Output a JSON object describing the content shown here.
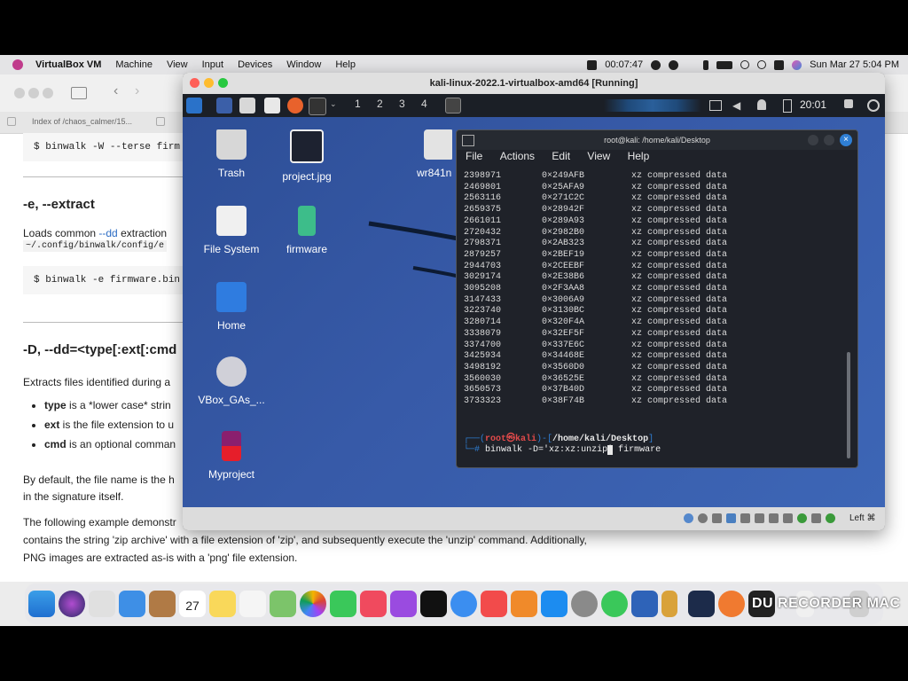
{
  "menubar": {
    "app": "VirtualBox VM",
    "items": [
      "Machine",
      "View",
      "Input",
      "Devices",
      "Window",
      "Help"
    ],
    "timer": "00:07:47",
    "datetime": "Sun Mar 27  5:04 PM"
  },
  "browser": {
    "tab1": "Index of /chaos_calmer/15...",
    "code1": "$ binwalk -W --terse firm",
    "h_extract": "-e, --extract",
    "p_loads_a": "Loads common ",
    "p_loads_link": "--dd",
    "p_loads_b": " extraction",
    "p_loads_path": "~/.config/binwalk/config/e",
    "code2": "$ binwalk -e firmware.bin",
    "h_dd": "-D, --dd=<type[:ext[:cmd",
    "p_extracts": "Extracts files identified during a",
    "li_type_b": "type",
    "li_type": " is a *lower case* strin",
    "li_ext_b": "ext",
    "li_ext": " is the file extension to u",
    "li_cmd_b": "cmd",
    "li_cmd": " is an optional comman",
    "p_default1": "By default, the file name is the h",
    "p_default2": "in the signature itself.",
    "p_following1": "The following example demonstr",
    "p_following2": "contains the string 'zip archive' with a file extension of 'zip', and subsequently execute the 'unzip' command. Additionally,",
    "p_following3": "PNG images are extracted as-is with a 'png' file extension."
  },
  "vm": {
    "title": "kali-linux-2022.1-virtualbox-amd64 [Running]",
    "panel": {
      "workspaces": [
        "1",
        "2",
        "3",
        "4"
      ],
      "clock": "20:01"
    },
    "desktop_icons": [
      {
        "label": "Trash"
      },
      {
        "label": "project.jpg"
      },
      {
        "label": "wr841n"
      },
      {
        "label": "File System"
      },
      {
        "label": "firmware"
      },
      {
        "label": "Home"
      },
      {
        "label": "VBox_GAs_..."
      },
      {
        "label": "Myproject"
      }
    ],
    "status_right": "Left ⌘"
  },
  "terminal": {
    "title": "root@kali: /home/kali/Desktop",
    "menu": [
      "File",
      "Actions",
      "Edit",
      "View",
      "Help"
    ],
    "rows": [
      {
        "dec": "2398971",
        "hex": "0×249AFB",
        "desc": "xz compressed data"
      },
      {
        "dec": "2469801",
        "hex": "0×25AFA9",
        "desc": "xz compressed data"
      },
      {
        "dec": "2563116",
        "hex": "0×271C2C",
        "desc": "xz compressed data"
      },
      {
        "dec": "2659375",
        "hex": "0×28942F",
        "desc": "xz compressed data"
      },
      {
        "dec": "2661011",
        "hex": "0×289A93",
        "desc": "xz compressed data"
      },
      {
        "dec": "2720432",
        "hex": "0×2982B0",
        "desc": "xz compressed data"
      },
      {
        "dec": "2798371",
        "hex": "0×2AB323",
        "desc": "xz compressed data"
      },
      {
        "dec": "2879257",
        "hex": "0×2BEF19",
        "desc": "xz compressed data"
      },
      {
        "dec": "2944703",
        "hex": "0×2CEEBF",
        "desc": "xz compressed data"
      },
      {
        "dec": "3029174",
        "hex": "0×2E38B6",
        "desc": "xz compressed data"
      },
      {
        "dec": "3095208",
        "hex": "0×2F3AA8",
        "desc": "xz compressed data"
      },
      {
        "dec": "3147433",
        "hex": "0×3006A9",
        "desc": "xz compressed data"
      },
      {
        "dec": "3223740",
        "hex": "0×3130BC",
        "desc": "xz compressed data"
      },
      {
        "dec": "3280714",
        "hex": "0×320F4A",
        "desc": "xz compressed data"
      },
      {
        "dec": "3338079",
        "hex": "0×32EF5F",
        "desc": "xz compressed data"
      },
      {
        "dec": "3374700",
        "hex": "0×337E6C",
        "desc": "xz compressed data"
      },
      {
        "dec": "3425934",
        "hex": "0×34468E",
        "desc": "xz compressed data"
      },
      {
        "dec": "3498192",
        "hex": "0×3560D0",
        "desc": "xz compressed data"
      },
      {
        "dec": "3560030",
        "hex": "0×36525E",
        "desc": "xz compressed data"
      },
      {
        "dec": "3650573",
        "hex": "0×37B40D",
        "desc": "xz compressed data"
      },
      {
        "dec": "3733323",
        "hex": "0×38F74B",
        "desc": "xz compressed data"
      }
    ],
    "prompt_user": "root㉿kali",
    "prompt_dir": "/home/kali/Desktop",
    "command": "binwalk -D='xz:xz:unzip",
    "command_tail": " firmware"
  },
  "dock": {
    "calendar_day": "27"
  },
  "watermark": "DU RECORDER MAC",
  "colors": {
    "kali_desktop": "#375aa8",
    "terminal_bg": "#1f2229",
    "prompt_blue": "#2f7fd4",
    "prompt_red": "#e24a4a",
    "link": "#2b6cc4"
  }
}
